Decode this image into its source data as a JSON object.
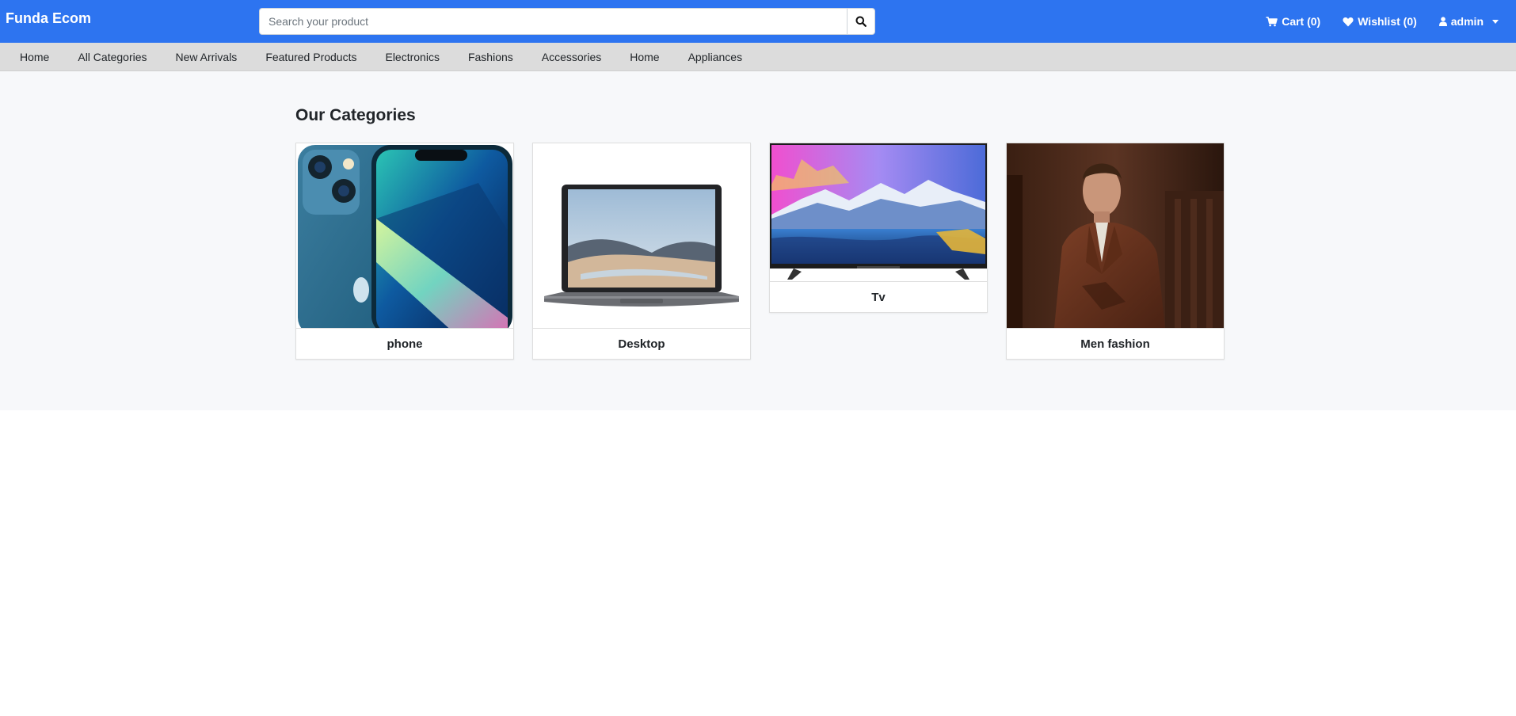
{
  "header": {
    "brand": "Funda Ecom",
    "search_placeholder": "Search your product",
    "search_icon": "search-icon",
    "cart_label": "Cart (0)",
    "wishlist_label": "Wishlist (0)",
    "user_label": "admin",
    "colors": {
      "bar": "#2d74f0"
    }
  },
  "nav": {
    "items": [
      {
        "label": "Home"
      },
      {
        "label": "All Categories"
      },
      {
        "label": "New Arrivals"
      },
      {
        "label": "Featured Products"
      },
      {
        "label": "Electronics"
      },
      {
        "label": "Fashions"
      },
      {
        "label": "Accessories"
      },
      {
        "label": "Home"
      },
      {
        "label": "Appliances"
      }
    ]
  },
  "main": {
    "title": "Our Categories",
    "categories": [
      {
        "name": "phone",
        "image": "phone-photo"
      },
      {
        "name": "Desktop",
        "image": "laptop-photo"
      },
      {
        "name": "Tv",
        "image": "tv-photo"
      },
      {
        "name": "Men fashion",
        "image": "man-suit-photo"
      }
    ]
  }
}
